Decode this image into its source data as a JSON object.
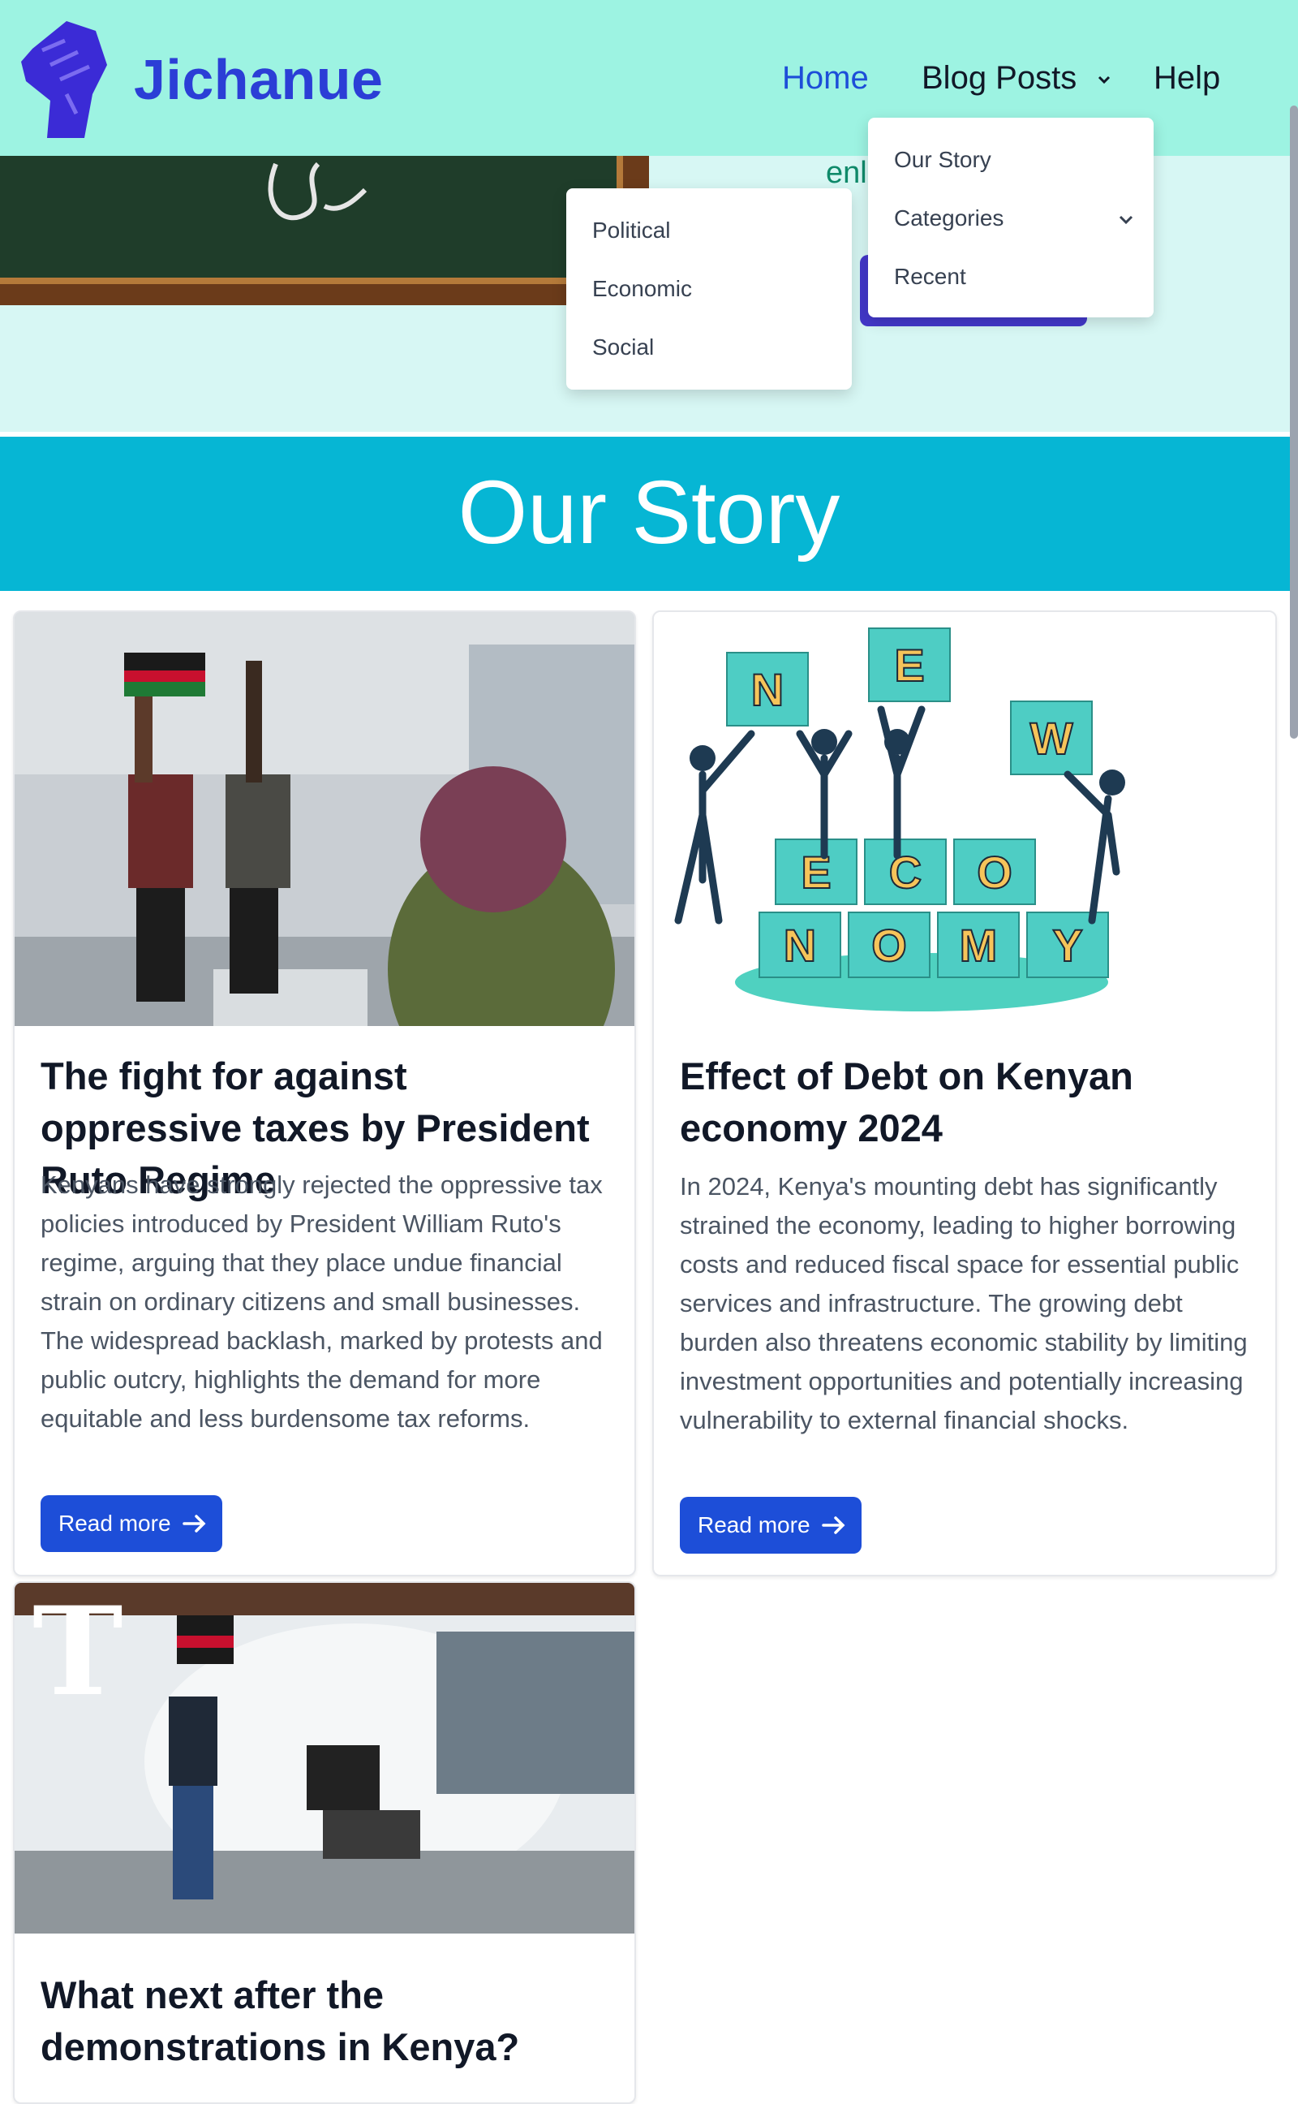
{
  "brand": {
    "name": "Jichanue",
    "logo_icon": "raised-fist-icon",
    "color": "#2b3ed6"
  },
  "nav": {
    "home": "Home",
    "blog_posts": "Blog Posts",
    "help": "Help"
  },
  "blog_dropdown": {
    "items": [
      "Our Story",
      "Categories",
      "Recent"
    ]
  },
  "categories_dropdown": {
    "items": [
      "Political",
      "Economic",
      "Social"
    ]
  },
  "hero": {
    "partial_text": "enl"
  },
  "banner": {
    "title": "Our Story",
    "color": "#06b6d4"
  },
  "posts": [
    {
      "title": "The fight for against oppressive taxes by President Ruto Regime",
      "summary": "Kenyans have strongly rejected the oppressive tax policies introduced by President William Ruto's regime, arguing that they place undue financial strain on ordinary citizens and small businesses. The widespread backlash, marked by protests and public outcry, highlights the demand for more equitable and less burdensome tax reforms.",
      "button": "Read more"
    },
    {
      "title": "Effect of Debt on Kenyan economy 2024",
      "summary": "In 2024, Kenya's mounting debt has significantly strained the economy, leading to higher borrowing costs and reduced fiscal space for essential public services and infrastructure. The growing debt burden also threatens economic stability by limiting investment opportunities and potentially increasing vulnerability to external financial shocks.",
      "button": "Read more",
      "image_letters": [
        "N",
        "E",
        "W",
        "E",
        "C",
        "O",
        "N",
        "O",
        "M",
        "Y"
      ]
    },
    {
      "title": "What next after the demonstrations in Kenya?",
      "image_watermark": "T"
    }
  ]
}
